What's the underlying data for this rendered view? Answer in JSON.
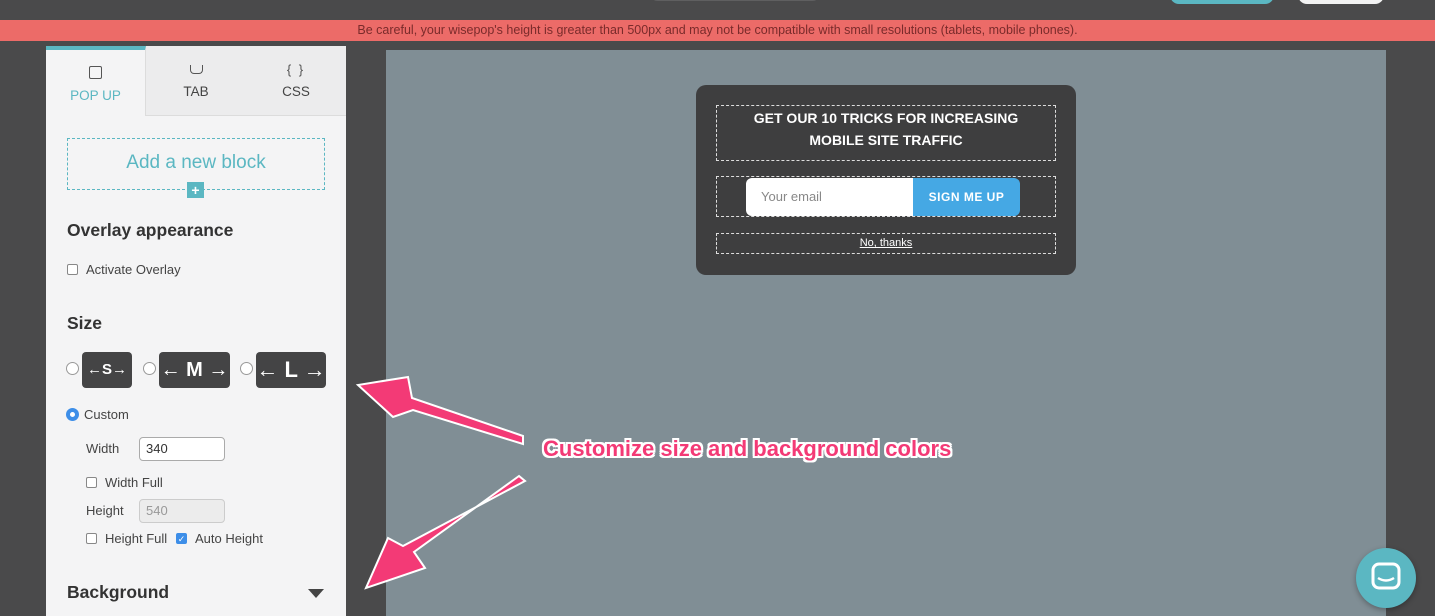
{
  "warning_banner": "Be careful, your wisepop's height is greater than 500px and may not be compatible with small resolutions (tablets, mobile phones).",
  "tabs": [
    {
      "label": "POP UP",
      "icon": "square-icon",
      "active": true
    },
    {
      "label": "TAB",
      "icon": "tab-icon",
      "active": false
    },
    {
      "label": "CSS",
      "icon": "braces-icon",
      "active": false
    }
  ],
  "tab_icons": {
    "css": "{ }"
  },
  "add_block": {
    "label": "Add a new block",
    "plus": "+"
  },
  "overlay": {
    "title": "Overlay appearance",
    "activate_label": "Activate Overlay"
  },
  "size": {
    "title": "Size",
    "presets": [
      "S",
      "M",
      "L"
    ],
    "custom_label": "Custom",
    "width_label": "Width",
    "width_value": "340",
    "width_full_label": "Width Full",
    "height_label": "Height",
    "height_value": "540",
    "height_full_label": "Height Full",
    "auto_height_label": "Auto Height"
  },
  "background": {
    "title": "Background"
  },
  "popup": {
    "title": "GET OUR 10 TRICKS FOR INCREASING MOBILE SITE TRAFFIC",
    "email_placeholder": "Your email",
    "submit_label": "SIGN ME UP",
    "dismiss_label": "No, thanks"
  },
  "annotation": "Customize size and background colors",
  "colors": {
    "accent": "#5bb7c2",
    "warning": "#ec6b68",
    "annotation": "#f33a76",
    "submit": "#45a8e4",
    "canvas": "#808e95"
  }
}
